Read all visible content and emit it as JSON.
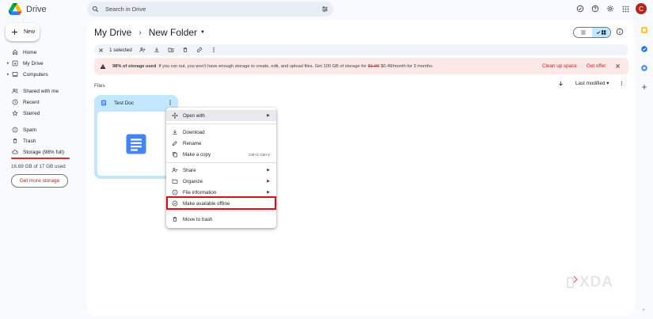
{
  "app": {
    "name": "Drive",
    "avatar_letter": "C"
  },
  "search": {
    "placeholder": "Search in Drive"
  },
  "sidebar": {
    "new_label": "New",
    "items": [
      {
        "label": "Home",
        "icon": "home-icon"
      },
      {
        "label": "My Drive",
        "icon": "my-drive-icon"
      },
      {
        "label": "Computers",
        "icon": "computers-icon"
      },
      {
        "label": "Shared with me",
        "icon": "shared-icon"
      },
      {
        "label": "Recent",
        "icon": "recent-icon"
      },
      {
        "label": "Starred",
        "icon": "starred-icon"
      },
      {
        "label": "Spam",
        "icon": "spam-icon"
      },
      {
        "label": "Trash",
        "icon": "trash-icon"
      },
      {
        "label": "Storage (98% full)",
        "icon": "cloud-icon"
      }
    ],
    "storage_used": "16.69 GB of 17 GB used",
    "storage_fraction": 0.98,
    "get_storage_label": "Get more storage"
  },
  "breadcrumb": {
    "root": "My Drive",
    "current": "New Folder"
  },
  "selection": {
    "count_label": "1 selected"
  },
  "banner": {
    "bold": "98% of storage used",
    "text": "If you run out, you won't have enough storage to create, edit, and upload files. Get 100 GB of storage for",
    "old_price": "$1.99",
    "new_price": "$0.49/month for 3 months.",
    "cleanup_label": "Clean up space",
    "offer_label": "Get offer"
  },
  "files": {
    "section_label": "Files",
    "sort_label": "Last modified"
  },
  "file_card": {
    "name": "Test Doc"
  },
  "context_menu": {
    "open_with": "Open with",
    "download": "Download",
    "rename": "Rename",
    "make_copy": "Make a copy",
    "make_copy_shortcut": "Ctrl+C Ctrl+V",
    "share": "Share",
    "organize": "Organize",
    "file_info": "File information",
    "offline": "Make available offline",
    "trash": "Move to trash"
  },
  "watermark": "XDA",
  "colors": {
    "accent": "#0b57d0",
    "selected": "#c2e7ff",
    "warning_bg": "#fce8e6",
    "danger": "#d93025",
    "highlight_box": "#d0121a"
  }
}
